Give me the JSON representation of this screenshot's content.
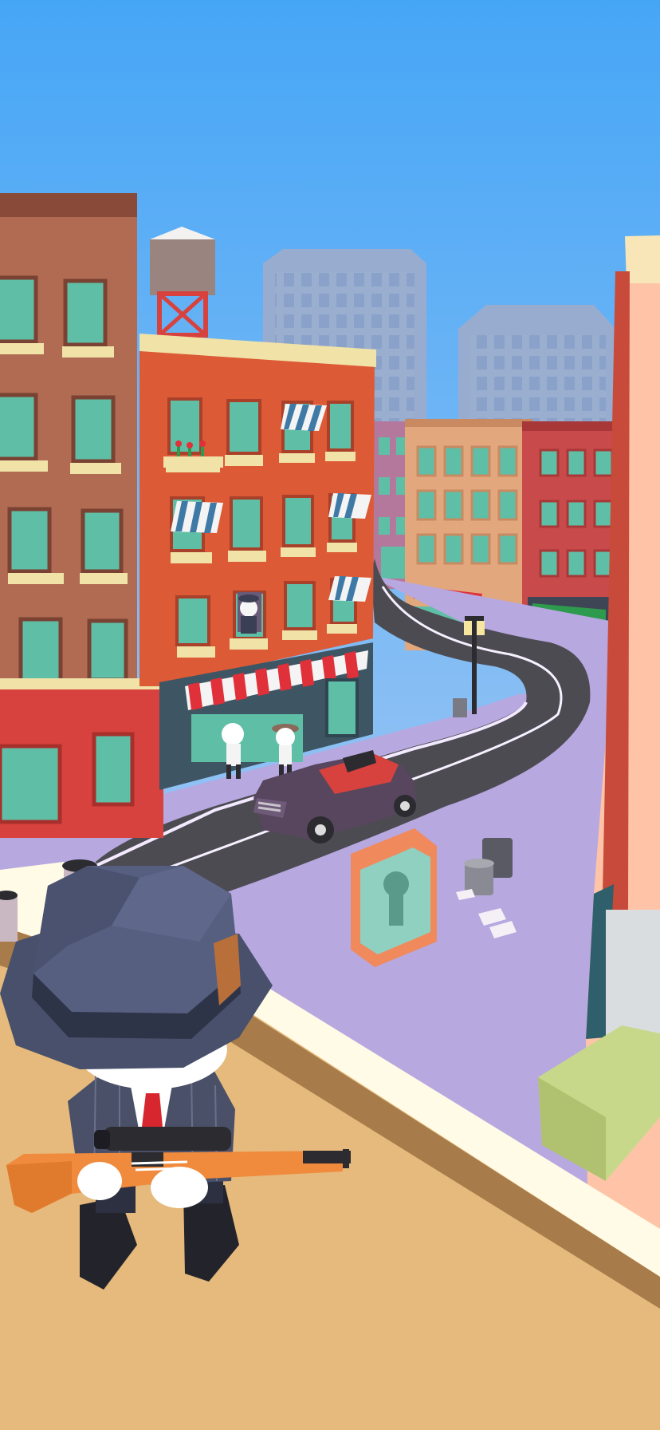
{
  "game": {
    "scene": "rooftop-sniper-city-street",
    "hud": []
  },
  "colors": {
    "sky_top": "#4aa9f7",
    "sky_bottom": "#c4c8f0",
    "road": "#4d4b52",
    "sidewalk": "#b7a8e0",
    "brick_orange": "#dc5a36",
    "brick_brown": "#b06b52",
    "window": "#5fbfa6",
    "awning_red": "#e0303a",
    "rooftop": "#e6b97c",
    "hat": "#48506b"
  }
}
